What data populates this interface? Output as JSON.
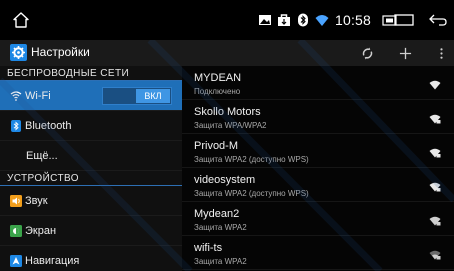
{
  "statusbar": {
    "time": "10:58",
    "icons": [
      "home-icon",
      "picture-icon",
      "bag-icon",
      "bluetooth-icon",
      "wifi-icon",
      "sd-card-icon",
      "window-icon",
      "back-icon"
    ]
  },
  "actionbar": {
    "title": "Настройки",
    "app_icon": "settings-gear-icon",
    "actions": [
      "wps-icon",
      "add-icon",
      "overflow-menu-icon"
    ]
  },
  "left": {
    "sections": [
      {
        "header": "БЕСПРОВОДНЫЕ СЕТИ",
        "items": [
          {
            "label": "Wi-Fi",
            "icon": "wifi-icon",
            "selected": true,
            "toggle": "ВКЛ"
          },
          {
            "label": "Bluetooth",
            "icon": "bluetooth-icon"
          },
          {
            "label": "Ещё..."
          }
        ]
      },
      {
        "header": "УСТРОЙСТВО",
        "items": [
          {
            "label": "Звук",
            "icon": "sound-icon"
          },
          {
            "label": "Экран",
            "icon": "display-icon"
          },
          {
            "label": "Навигация",
            "icon": "navigation-icon"
          }
        ]
      }
    ]
  },
  "networks": [
    {
      "name": "MYDEAN",
      "status": "Подключено",
      "secured": false
    },
    {
      "name": "Skollo Motors",
      "status": "Защита WPA/WPA2",
      "secured": true
    },
    {
      "name": "Privod-M",
      "status": "Защита WPA2 (доступно WPS)",
      "secured": true
    },
    {
      "name": "videosystem",
      "status": "Защита WPA2 (доступно WPS)",
      "secured": true
    },
    {
      "name": "Mydean2",
      "status": "Защита WPA2",
      "secured": true
    },
    {
      "name": "wifi-ts",
      "status": "Защита WPA2",
      "secured": true
    }
  ],
  "colors": {
    "accent": "#1f6fb8",
    "toggle_on": "#3f96e4",
    "background": "#000000"
  }
}
